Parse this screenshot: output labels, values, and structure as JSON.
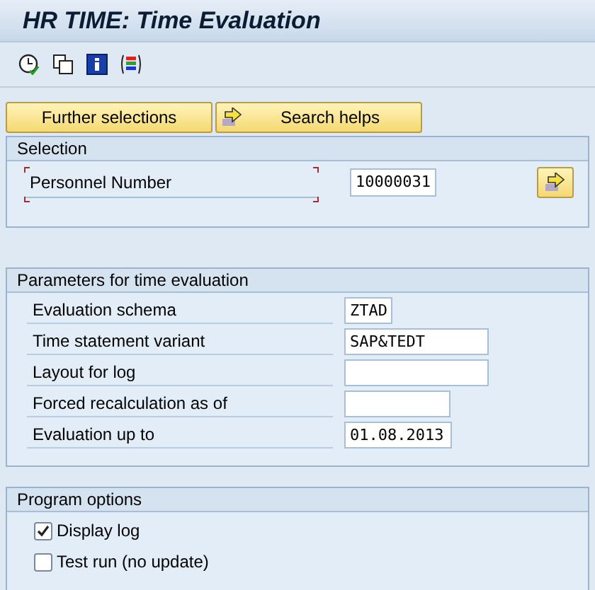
{
  "window": {
    "title": "HR TIME: Time Evaluation"
  },
  "buttons": [
    {
      "label": "Further selections",
      "kind": "plain"
    },
    {
      "label": "Search helps",
      "kind": "arrow"
    }
  ],
  "selection": {
    "title": "Selection",
    "fields": [
      {
        "label": "Personnel Number",
        "value": "10000031",
        "focused": true
      }
    ]
  },
  "parameters": {
    "title": "Parameters for time evaluation",
    "fields": [
      {
        "label": "Evaluation schema",
        "value": "ZTAD"
      },
      {
        "label": "Time statement variant",
        "value": "SAP&TEDT"
      },
      {
        "label": "Layout for log"
      },
      {
        "label": "Forced recalculation as of"
      },
      {
        "label": "Evaluation up to",
        "value": "01.08.2013"
      }
    ]
  },
  "program_options": {
    "title": "Program options",
    "options": [
      {
        "label": "Display log",
        "checked": true
      },
      {
        "label": "Test run (no update)",
        "checked": false
      }
    ]
  }
}
